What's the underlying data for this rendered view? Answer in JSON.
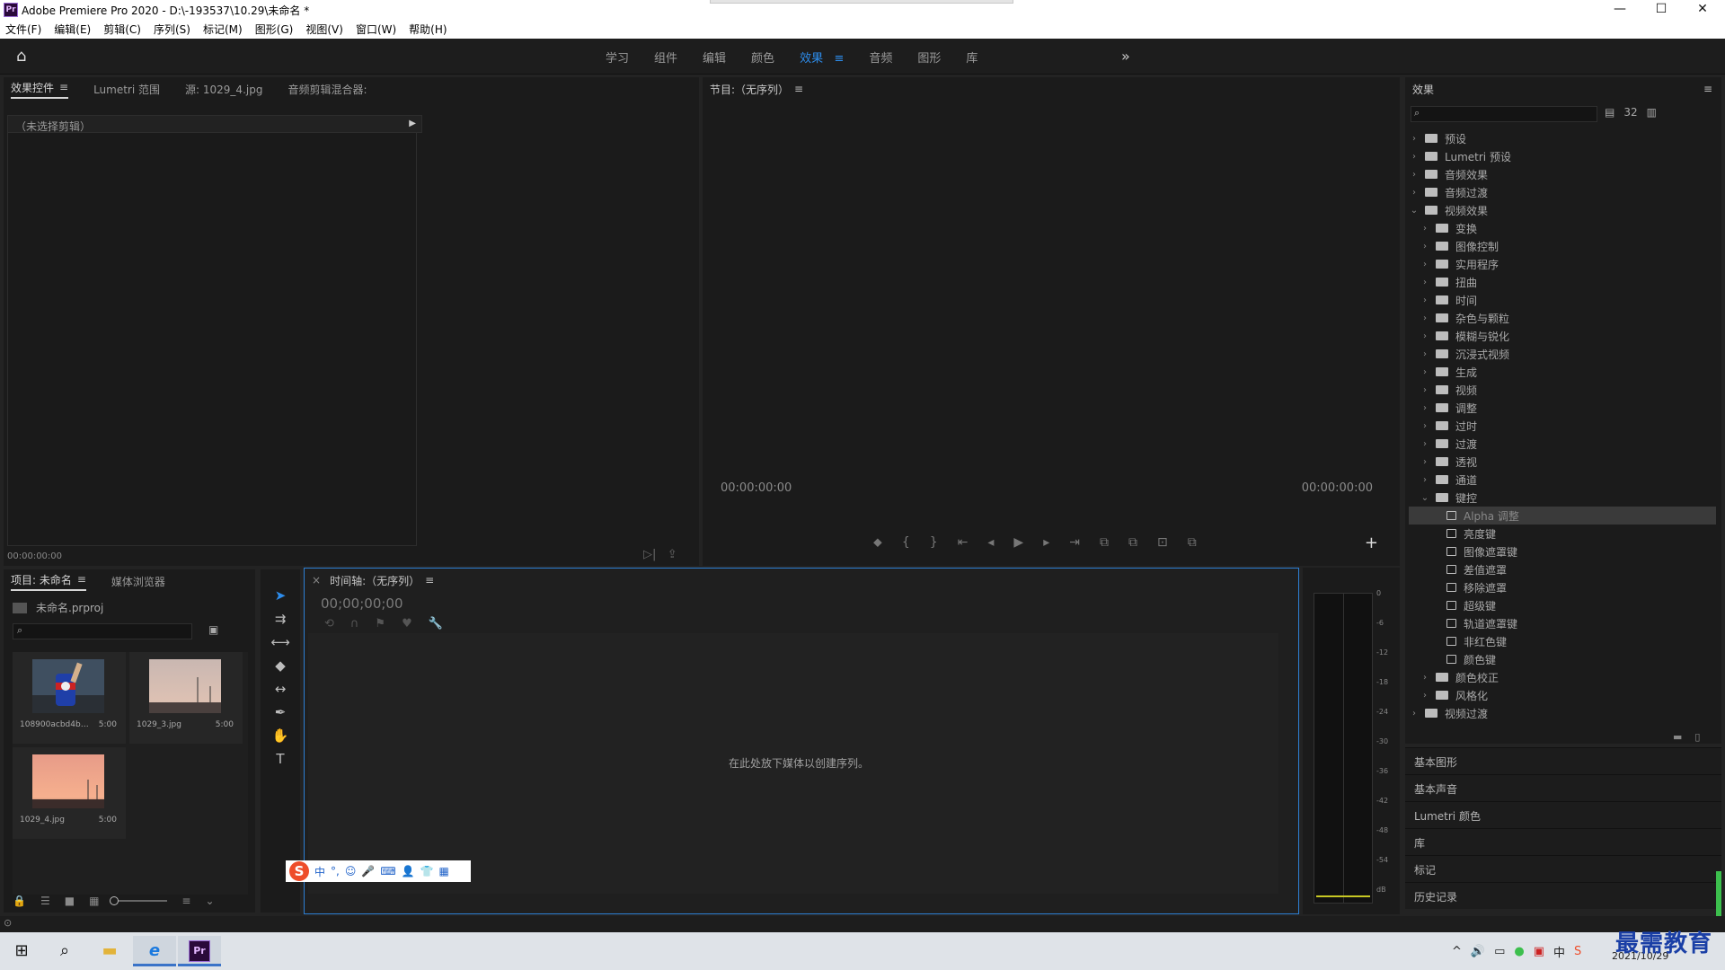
{
  "window": {
    "title": "Adobe Premiere Pro 2020 - D:\\-193537\\10.29\\未命名 *",
    "logo": "Pr",
    "buttons": {
      "minimize": "—",
      "maximize": "☐",
      "close": "✕"
    }
  },
  "menu": [
    "文件(F)",
    "编辑(E)",
    "剪辑(C)",
    "序列(S)",
    "标记(M)",
    "图形(G)",
    "视图(V)",
    "窗口(W)",
    "帮助(H)"
  ],
  "workspaces": {
    "tabs": [
      "学习",
      "组件",
      "编辑",
      "颜色",
      "效果",
      "音频",
      "图形",
      "库"
    ],
    "active": "效果",
    "active_menu": "≡",
    "more": "»"
  },
  "effect_controls": {
    "tabs": [
      "效果控件",
      "Lumetri 范围",
      "源: 1029_4.jpg",
      "音频剪辑混合器:"
    ],
    "menu": "≡",
    "no_clip": "（未选择剪辑）",
    "timecode": "00:00:00:00"
  },
  "program": {
    "title": "节目:（无序列）",
    "menu": "≡",
    "tc_left": "00:00:00:00",
    "tc_right": "00:00:00:00",
    "controls": [
      "⬥",
      "{",
      "}",
      "⇤",
      "◂",
      "▶",
      "▸",
      "⇥",
      "⧉",
      "⧉",
      "⊡",
      "⧉"
    ],
    "add": "+"
  },
  "effects": {
    "title": "效果",
    "menu": "≡",
    "search_icon": "⌕",
    "top_icons": [
      "▤",
      "32",
      "▥"
    ],
    "tree": [
      {
        "label": "预设",
        "level": 0,
        "type": "folder",
        "open": false
      },
      {
        "label": "Lumetri 预设",
        "level": 0,
        "type": "folder",
        "open": false
      },
      {
        "label": "音频效果",
        "level": 0,
        "type": "folder",
        "open": false
      },
      {
        "label": "音频过渡",
        "level": 0,
        "type": "folder",
        "open": false
      },
      {
        "label": "视频效果",
        "level": 0,
        "type": "folder",
        "open": true
      },
      {
        "label": "变换",
        "level": 1,
        "type": "folder",
        "open": false
      },
      {
        "label": "图像控制",
        "level": 1,
        "type": "folder",
        "open": false
      },
      {
        "label": "实用程序",
        "level": 1,
        "type": "folder",
        "open": false
      },
      {
        "label": "扭曲",
        "level": 1,
        "type": "folder",
        "open": false
      },
      {
        "label": "时间",
        "level": 1,
        "type": "folder",
        "open": false
      },
      {
        "label": "杂色与颗粒",
        "level": 1,
        "type": "folder",
        "open": false
      },
      {
        "label": "模糊与锐化",
        "level": 1,
        "type": "folder",
        "open": false
      },
      {
        "label": "沉浸式视频",
        "level": 1,
        "type": "folder",
        "open": false
      },
      {
        "label": "生成",
        "level": 1,
        "type": "folder",
        "open": false
      },
      {
        "label": "视频",
        "level": 1,
        "type": "folder",
        "open": false
      },
      {
        "label": "调整",
        "level": 1,
        "type": "folder",
        "open": false
      },
      {
        "label": "过时",
        "level": 1,
        "type": "folder",
        "open": false
      },
      {
        "label": "过渡",
        "level": 1,
        "type": "folder",
        "open": false
      },
      {
        "label": "透视",
        "level": 1,
        "type": "folder",
        "open": false
      },
      {
        "label": "通道",
        "level": 1,
        "type": "folder",
        "open": false
      },
      {
        "label": "键控",
        "level": 1,
        "type": "folder",
        "open": true
      },
      {
        "label": "Alpha 调整",
        "level": 2,
        "type": "effect",
        "selected": true
      },
      {
        "label": "亮度键",
        "level": 2,
        "type": "effect"
      },
      {
        "label": "图像遮罩键",
        "level": 2,
        "type": "effect"
      },
      {
        "label": "差值遮罩",
        "level": 2,
        "type": "effect"
      },
      {
        "label": "移除遮罩",
        "level": 2,
        "type": "effect"
      },
      {
        "label": "超级键",
        "level": 2,
        "type": "effect"
      },
      {
        "label": "轨道遮罩键",
        "level": 2,
        "type": "effect"
      },
      {
        "label": "非红色键",
        "level": 2,
        "type": "effect"
      },
      {
        "label": "颜色键",
        "level": 2,
        "type": "effect"
      },
      {
        "label": "颜色校正",
        "level": 1,
        "type": "folder",
        "open": false
      },
      {
        "label": "风格化",
        "level": 1,
        "type": "folder",
        "open": false
      },
      {
        "label": "视频过渡",
        "level": 0,
        "type": "folder",
        "open": false
      }
    ],
    "bottom_icons": [
      "▬",
      "▯"
    ]
  },
  "collapsed_panels": [
    "基本图形",
    "基本声音",
    "Lumetri 颜色",
    "库",
    "标记",
    "历史记录"
  ],
  "project": {
    "tabs": [
      "项目: 未命名",
      "媒体浏览器"
    ],
    "menu": "≡",
    "file": "未命名.prproj",
    "search_icon": "⌕",
    "bin_icon": "▣",
    "items": [
      {
        "name": "108900acbd4b738...",
        "duration": "5:00",
        "kind": "can"
      },
      {
        "name": "1029_3.jpg",
        "duration": "5:00",
        "kind": "dusk"
      },
      {
        "name": "1029_4.jpg",
        "duration": "5:00",
        "kind": "sunset"
      }
    ],
    "footer": [
      "🔒",
      "☰",
      "■",
      "▦",
      "≡",
      "⌄"
    ]
  },
  "tools": [
    "➤",
    "⇉",
    "⟷",
    "◆",
    "↔",
    "✒",
    "✋",
    "T"
  ],
  "timeline": {
    "close": "×",
    "title": "时间轴:（无序列）",
    "menu": "≡",
    "timecode": "00;00;00;00",
    "icons": [
      "⟲",
      "∩",
      "⚑",
      "♥",
      "🔧"
    ],
    "drop_text": "在此处放下媒体以创建序列。"
  },
  "meter": {
    "scale": [
      "0",
      "-6",
      "-12",
      "-18",
      "-24",
      "-30",
      "-36",
      "-42",
      "-48",
      "-54",
      "dB"
    ]
  },
  "ime": {
    "logo": "S",
    "icons": [
      "中",
      "°,",
      "☺",
      "🎤",
      "⌨",
      "👤",
      "👕",
      "▦"
    ]
  },
  "taskbar": {
    "icons": [
      "⊞",
      "⌕",
      "▬",
      "e",
      "Pr"
    ],
    "tray": [
      "^",
      "🔊",
      "▭",
      "●",
      "▣",
      "中",
      "S"
    ],
    "time": "2021/10/29",
    "brand": "最需教育"
  }
}
